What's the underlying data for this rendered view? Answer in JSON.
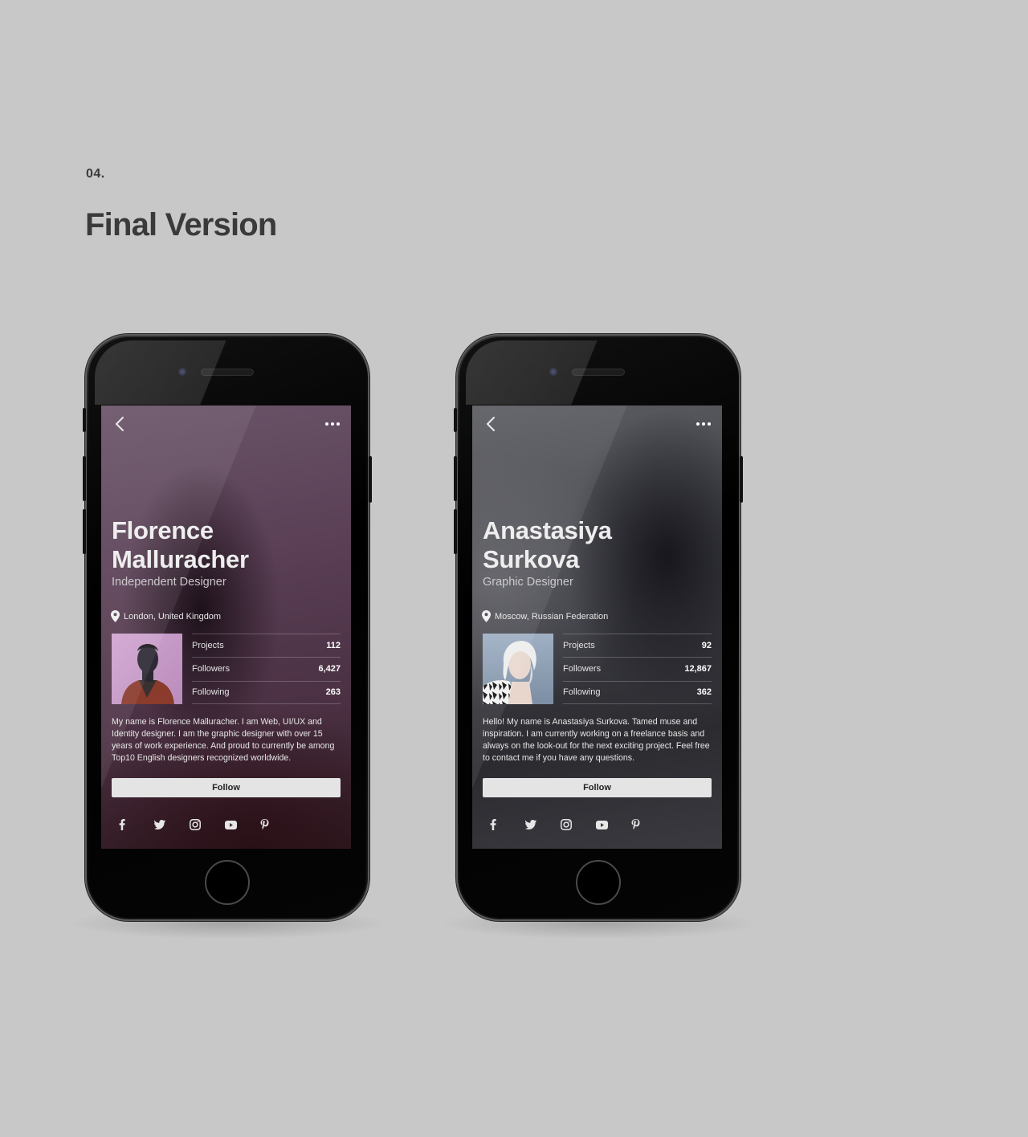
{
  "section": {
    "number": "04.",
    "title": "Final Version"
  },
  "colors": {
    "background": "#c8c8c8",
    "heading": "#3a3a3a"
  },
  "icons": {
    "back": "chevron-left-icon",
    "more": "more-dots-icon",
    "location": "location-pin-icon",
    "social": [
      "facebook-icon",
      "twitter-icon",
      "instagram-icon",
      "youtube-icon",
      "pinterest-icon"
    ]
  },
  "profiles": [
    {
      "name_line1": "Florence",
      "name_line2": "Malluracher",
      "role": "Independent Designer",
      "location": "London, United Kingdom",
      "stats": [
        {
          "label": "Projects",
          "value": "112"
        },
        {
          "label": "Followers",
          "value": "6,427"
        },
        {
          "label": "Following",
          "value": "263"
        }
      ],
      "bio": "My name is Florence Malluracher. I am Web, UI/UX and Identity designer. I am the graphic designer with over 15 years of work experience. And proud to currently be among Top10 English designers recognized worldwide.",
      "follow_label": "Follow"
    },
    {
      "name_line1": "Anastasiya",
      "name_line2": "Surkova",
      "role": "Graphic Designer",
      "location": "Moscow, Russian Federation",
      "stats": [
        {
          "label": "Projects",
          "value": "92"
        },
        {
          "label": "Followers",
          "value": "12,867"
        },
        {
          "label": "Following",
          "value": "362"
        }
      ],
      "bio": "Hello! My name is Anastasiya Surkova. Tamed muse and inspiration. I am currently working on a freelance basis and always on the look-out for the next exciting project. Feel free to contact me if you have any questions.",
      "follow_label": "Follow"
    }
  ]
}
